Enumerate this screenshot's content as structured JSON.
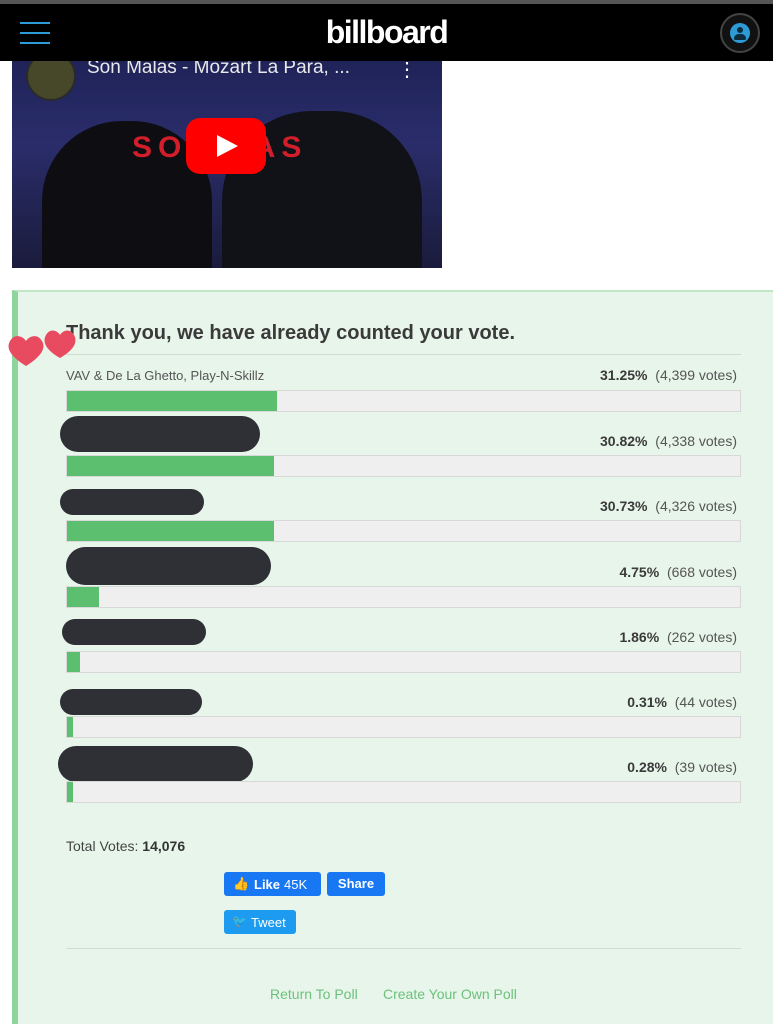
{
  "header": {
    "logo_text": "billboard",
    "menu_icon": "hamburger-menu-icon",
    "account_icon": "user-account-icon",
    "accent_color": "#2d9bd6"
  },
  "video": {
    "title": "Son Malas - Mozart La Para, ...",
    "more_label": "⋮",
    "overlay_text": "SON  LAS"
  },
  "poll": {
    "thank_you": "Thank you, we have already counted your vote.",
    "bar_color": "#5bbf6f",
    "results": [
      {
        "label": "VAV & De La Ghetto, Play-N-Skillz",
        "percent_text": "31.25%",
        "votes_text": "(4,399 votes)",
        "fraction": 0.3125
      },
      {
        "label": "",
        "percent_text": "30.82%",
        "votes_text": "(4,338 votes)",
        "fraction": 0.3082
      },
      {
        "label": "",
        "percent_text": "30.73%",
        "votes_text": "(4,326 votes)",
        "fraction": 0.3073
      },
      {
        "label": "",
        "percent_text": "4.75%",
        "votes_text": "(668 votes)",
        "fraction": 0.0475
      },
      {
        "label": "",
        "percent_text": "1.86%",
        "votes_text": "(262 votes)",
        "fraction": 0.0186
      },
      {
        "label": "",
        "percent_text": "0.31%",
        "votes_text": "(44 votes)",
        "fraction": 0.0031
      },
      {
        "label": "",
        "percent_text": "0.28%",
        "votes_text": "(39 votes)",
        "fraction": 0.0028
      }
    ],
    "total_label": "Total Votes:",
    "total_value": "14,076"
  },
  "social": {
    "like_label": "Like",
    "like_count": "45K",
    "share_label": "Share",
    "tweet_label": "Tweet"
  },
  "footer": {
    "return_link": "Return To Poll",
    "create_link": "Create Your Own Poll"
  }
}
